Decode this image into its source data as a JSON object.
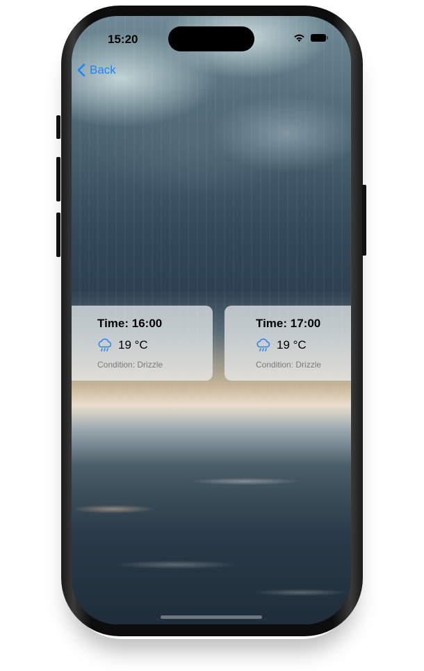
{
  "status_bar": {
    "time": "15:20",
    "icons": [
      "wifi-icon",
      "battery-icon"
    ]
  },
  "nav": {
    "back_label": "Back",
    "back_icon": "chevron-left-icon",
    "accent_color": "#1a84ff"
  },
  "background": {
    "description_icon": "rain-over-sea-photo"
  },
  "forecast": [
    {
      "time": "Time: 16:00",
      "icon": "cloud-drizzle-icon",
      "temperature": "19 °C",
      "condition": "Condition: Drizzle"
    },
    {
      "time": "Time: 17:00",
      "icon": "cloud-drizzle-icon",
      "temperature": "19 °C",
      "condition": "Condition: Drizzle"
    }
  ]
}
